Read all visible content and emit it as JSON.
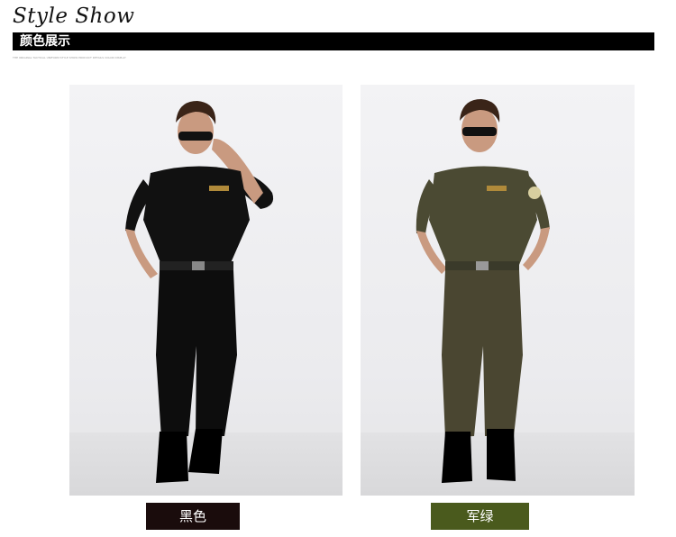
{
  "header": {
    "title": "Style Show",
    "section_label": "颜色展示",
    "fine_print": "THE ORIGINAL TACTICAL UNIFORM STYLE SHOW PRODUCT DETAILS COLOR DISPLAY"
  },
  "products": [
    {
      "color_label": "黑色",
      "tag_color": "#1a0c0c",
      "uniform_color": "#111111"
    },
    {
      "color_label": "军绿",
      "tag_color": "#4a5a1d",
      "uniform_color": "#4b4a33"
    }
  ]
}
